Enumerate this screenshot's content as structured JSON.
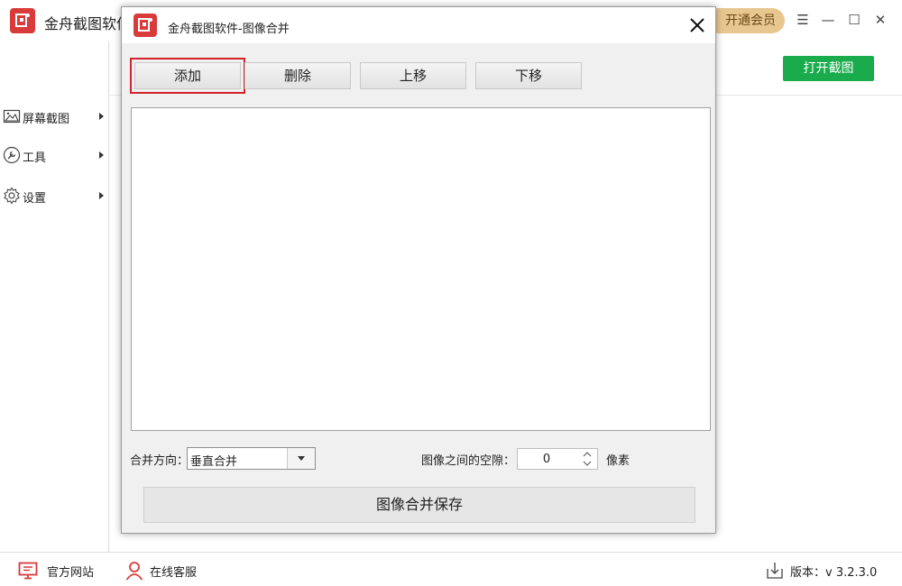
{
  "app": {
    "title": "金舟截图软件",
    "vip_label": "开通会员",
    "window_controls": {
      "menu": "☰",
      "minimize": "—",
      "maximize": "☐",
      "close": "✕"
    },
    "open_capture_label": "打开截图"
  },
  "sidebar": {
    "items": [
      {
        "label": "屏幕截图",
        "icon": "image-icon"
      },
      {
        "label": "工具",
        "icon": "wrench-icon"
      },
      {
        "label": "设置",
        "icon": "gear-icon"
      }
    ]
  },
  "statusbar": {
    "website_label": "官方网站",
    "support_label": "在线客服",
    "version_text": "版本：v 3.2.3.0"
  },
  "dialog": {
    "title": "金舟截图软件-图像合并",
    "buttons": {
      "add": "添加",
      "delete": "删除",
      "move_up": "上移",
      "move_down": "下移"
    },
    "direction_label": "合并方向：",
    "direction_value": "垂直合并",
    "spacing_label": "图像之间的空隙：",
    "spacing_value": "0",
    "spacing_unit": "像素",
    "save_label": "图像合并保存"
  },
  "colors": {
    "brand_red": "#d93a3a",
    "accent_green": "#1aac4c",
    "vip_gold": "#e8c690",
    "highlight_red": "#d2232a"
  }
}
